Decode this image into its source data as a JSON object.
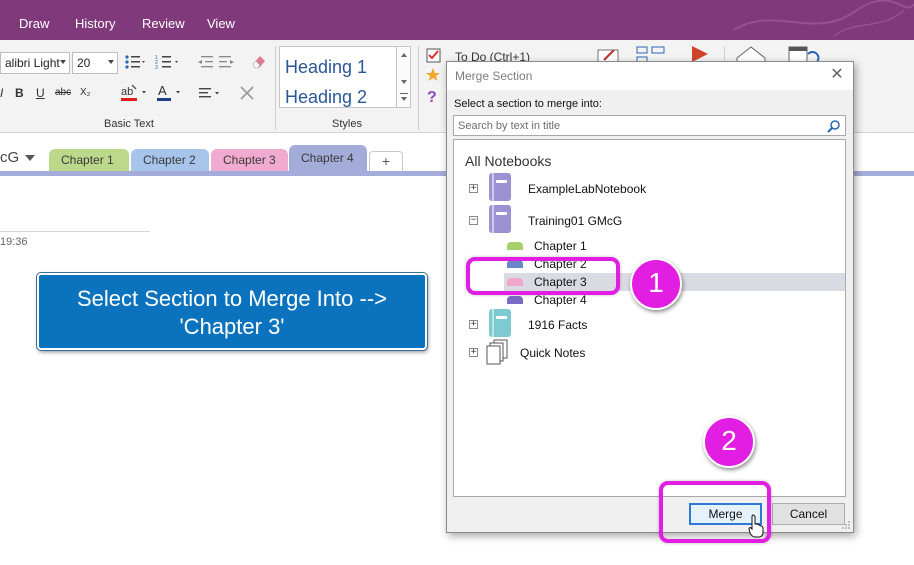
{
  "ribbon_tabs": [
    "Draw",
    "History",
    "Review",
    "View"
  ],
  "ribbon": {
    "font_name": "alibri Light",
    "font_size": "20",
    "group_basic_text": "Basic Text",
    "styles": [
      "Heading 1",
      "Heading 2"
    ],
    "group_styles": "Styles",
    "tag_item": "To Do (Ctrl+1)"
  },
  "notebook": {
    "name": "cG",
    "section_tabs": [
      {
        "label": "Chapter 1",
        "color": "#bcd88b"
      },
      {
        "label": "Chapter 2",
        "color": "#a7c5ea"
      },
      {
        "label": "Chapter 3",
        "color": "#f2abd0"
      },
      {
        "label": "Chapter 4",
        "color": "#a4acd9"
      }
    ],
    "add_tab": "+"
  },
  "page": {
    "time": "19:36"
  },
  "callout": {
    "line1": "Select Section to Merge Into -->",
    "line2": "'Chapter 3'"
  },
  "dialog": {
    "title": "Merge Section",
    "close": "✕",
    "prompt": "Select a section to merge into:",
    "search_placeholder": "Search by text in title",
    "tree_header": "All Notebooks",
    "notebooks": [
      {
        "label": "ExampleLabNotebook",
        "expander": "+",
        "color": "#9c91d2"
      },
      {
        "label": "Training01 GMcG",
        "expander": "−",
        "color": "#9c91d2"
      },
      {
        "label": "1916 Facts",
        "expander": "+",
        "color": "#7ecad2"
      },
      {
        "label": "Quick Notes",
        "expander": "+"
      }
    ],
    "sections": [
      {
        "label": "Chapter 1",
        "color": "#a7cf6a"
      },
      {
        "label": "Chapter 2",
        "color": "#6a87c9"
      },
      {
        "label": "Chapter 3",
        "color": "#f0a7c9"
      },
      {
        "label": "Chapter 4",
        "color": "#7a6cc4"
      }
    ],
    "merge_button": "Merge",
    "cancel_button": "Cancel"
  },
  "annotations": {
    "step1": "1",
    "step2": "2",
    "highlight_color": "#e21ee2"
  },
  "colors": {
    "ribbon_bar": "#80397b",
    "callout_bg": "#0b72bd"
  }
}
